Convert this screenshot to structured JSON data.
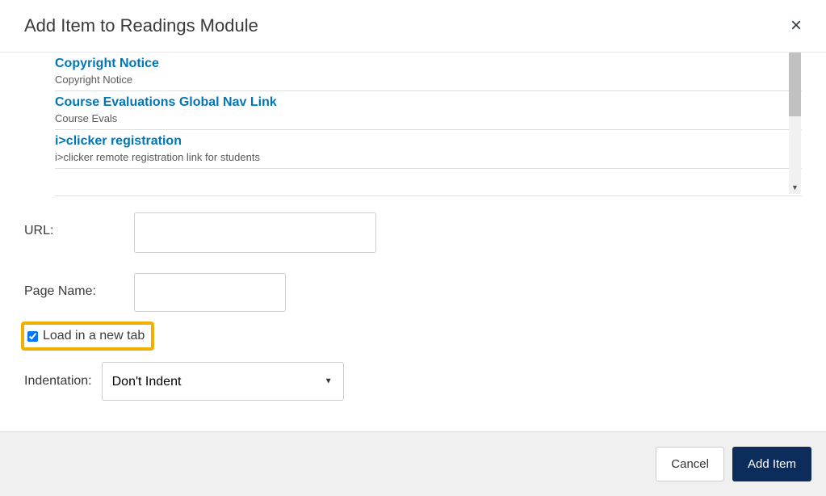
{
  "header": {
    "title": "Add Item to Readings Module",
    "close_label": "×"
  },
  "items": [
    {
      "title": "Copyright Notice",
      "subtitle": "Copyright Notice"
    },
    {
      "title": "Course Evaluations Global Nav Link",
      "subtitle": "Course Evals"
    },
    {
      "title": "i>clicker registration",
      "subtitle": "i>clicker remote registration link for students"
    }
  ],
  "form": {
    "url_label": "URL:",
    "url_value": "",
    "page_name_label": "Page Name:",
    "page_name_value": "",
    "load_new_tab_label": "Load in a new tab",
    "load_new_tab_checked": true,
    "indent_label": "Indentation:",
    "indent_value": "Don't Indent"
  },
  "footer": {
    "cancel_label": "Cancel",
    "add_label": "Add Item"
  }
}
